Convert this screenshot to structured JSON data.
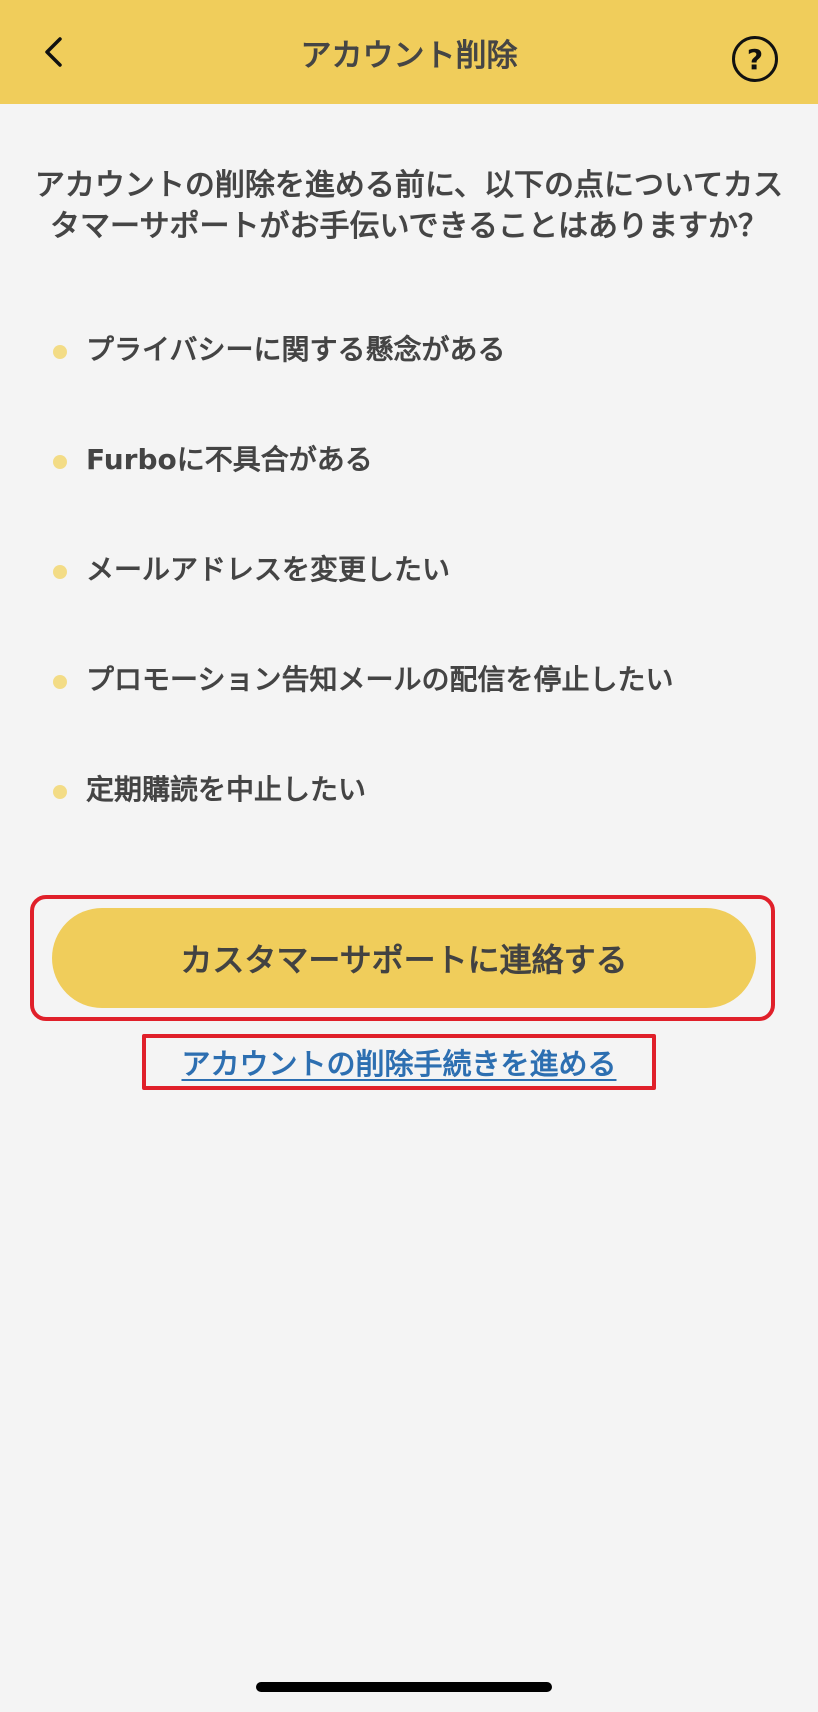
{
  "header": {
    "title": "アカウント削除",
    "back_icon": "chevron-left-icon",
    "help_icon": "question-circle-icon",
    "help_symbol": "?",
    "background_color": "#f0cd5b"
  },
  "intro": {
    "text": "アカウントの削除を進める前に、以下の点についてカスタマーサポートがお手伝いできることはありますか？"
  },
  "reasons": [
    {
      "label": "プライバシーに関する懸念がある"
    },
    {
      "label": "Furboに不具合がある"
    },
    {
      "label": "メールアドレスを変更したい"
    },
    {
      "label": "プロモーション告知メールの配信を停止したい"
    },
    {
      "label": "定期購読を中止したい"
    }
  ],
  "actions": {
    "contact_label": "カスタマーサポートに連絡する",
    "proceed_label": "アカウントの削除手続きを進める"
  },
  "colors": {
    "accent": "#f0cd5b",
    "bullet": "#f3dc86",
    "link": "#2d6fb1",
    "highlight": "#e0202a"
  }
}
